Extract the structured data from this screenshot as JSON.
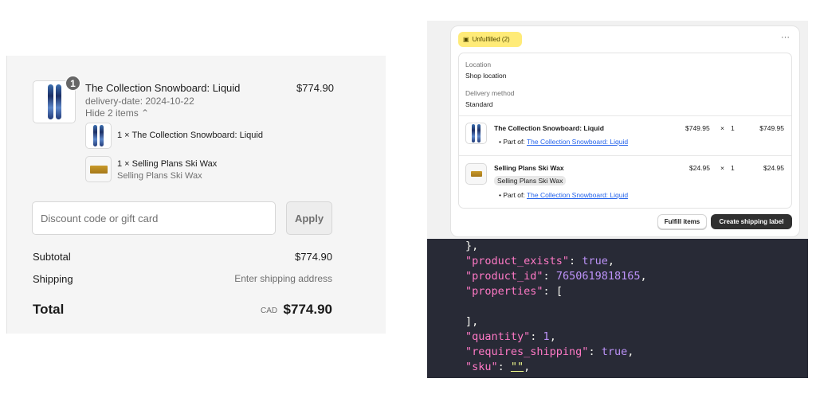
{
  "checkout": {
    "product_title": "The Collection Snowboard: Liquid",
    "quantity_badge": "1",
    "price": "$774.90",
    "delivery_date": "delivery-date: 2024-10-22",
    "toggle": "Hide 2 items",
    "components": [
      {
        "label": "1 × The Collection Snowboard: Liquid",
        "sub": ""
      },
      {
        "label": "1 × Selling Plans Ski Wax",
        "sub": "Selling Plans Ski Wax"
      }
    ],
    "discount_placeholder": "Discount code or gift card",
    "apply": "Apply",
    "subtotal_label": "Subtotal",
    "subtotal": "$774.90",
    "shipping_label": "Shipping",
    "shipping": "Enter shipping address",
    "total_label": "Total",
    "currency": "CAD",
    "total": "$774.90"
  },
  "fulfillment": {
    "status": "Unfulfilled (2)",
    "more": "···",
    "location_label": "Location",
    "location": "Shop location",
    "delivery_label": "Delivery method",
    "delivery": "Standard",
    "items": [
      {
        "title": "The Collection Snowboard: Liquid",
        "price": "$749.95",
        "times": "×",
        "qty": "1",
        "total": "$749.95",
        "part_of": "Part of:",
        "link": "The Collection Snowboard: Liquid"
      },
      {
        "title": "Selling Plans Ski Wax",
        "variant": "Selling Plans Ski Wax",
        "price": "$24.95",
        "times": "×",
        "qty": "1",
        "total": "$24.95",
        "part_of": "Part of:",
        "link": "The Collection Snowboard: Liquid"
      }
    ],
    "fulfill": "Fulfill items",
    "create_label": "Create shipping label"
  },
  "code": {
    "l0": "},",
    "l1k": "\"product_exists\"",
    "l1v": "true",
    "l2k": "\"product_id\"",
    "l2v": "7650619818165",
    "l3k": "\"properties\"",
    "l3v": "[",
    "l5": "],",
    "l6k": "\"quantity\"",
    "l6v": "1",
    "l7k": "\"requires_shipping\"",
    "l7v": "true",
    "l8k": "\"sku\"",
    "l8v": "\"\""
  }
}
